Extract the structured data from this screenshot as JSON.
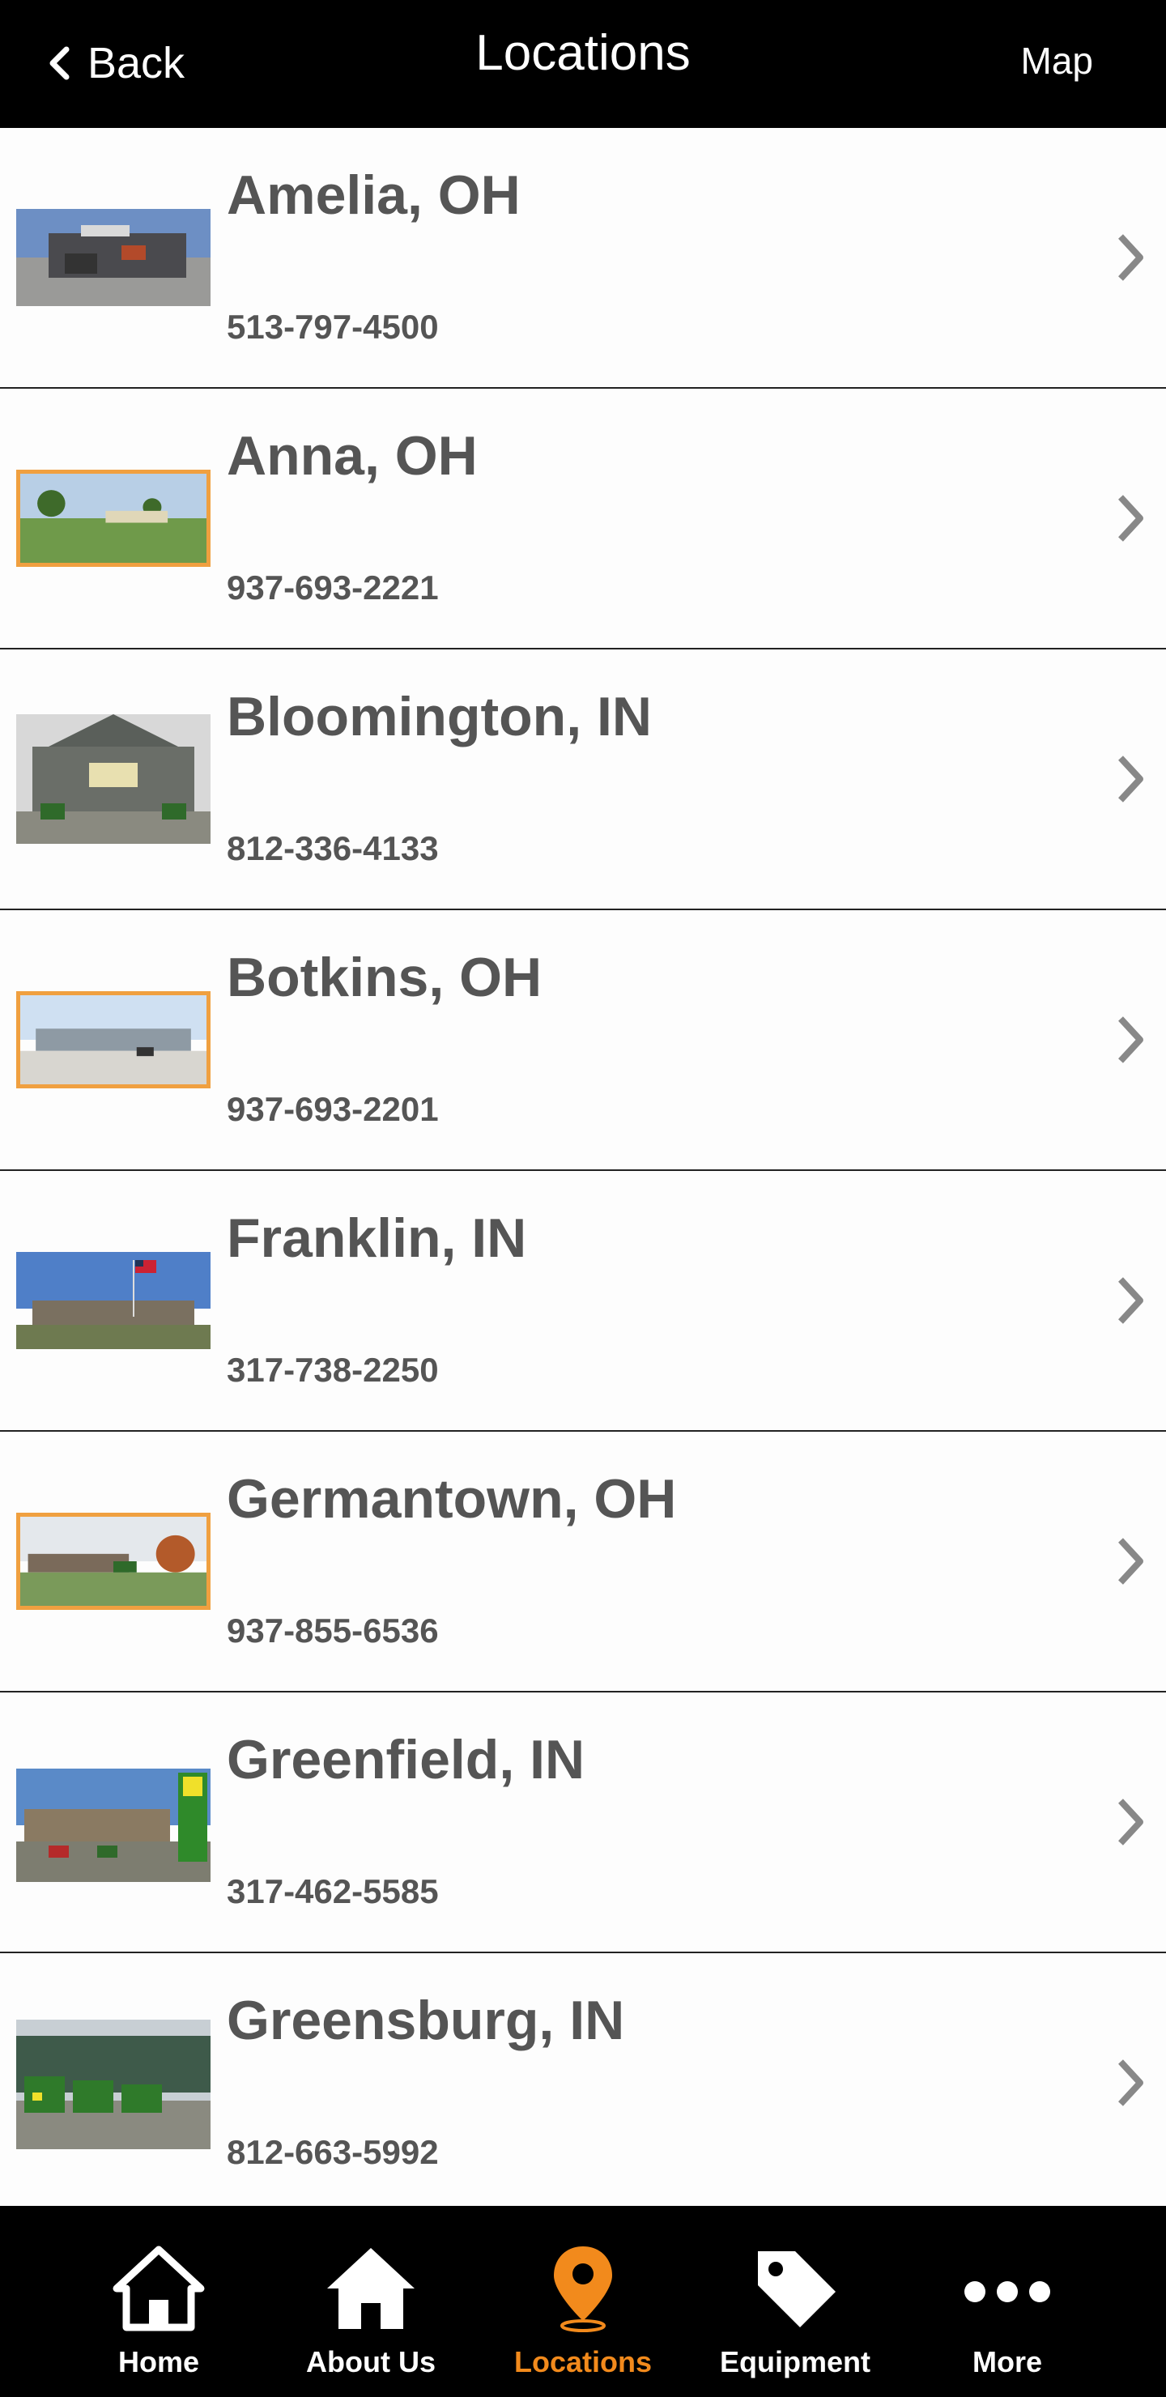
{
  "header": {
    "back_label": "Back",
    "title": "Locations",
    "map_label": "Map"
  },
  "locations": [
    {
      "name": "Amelia, OH",
      "phone": "513-797-4500"
    },
    {
      "name": "Anna, OH",
      "phone": "937-693-2221"
    },
    {
      "name": "Bloomington, IN",
      "phone": "812-336-4133"
    },
    {
      "name": "Botkins, OH",
      "phone": "937-693-2201"
    },
    {
      "name": "Franklin, IN",
      "phone": "317-738-2250"
    },
    {
      "name": "Germantown, OH",
      "phone": "937-855-6536"
    },
    {
      "name": "Greenfield, IN",
      "phone": "317-462-5585"
    },
    {
      "name": "Greensburg, IN",
      "phone": "812-663-5992"
    }
  ],
  "tabs": [
    {
      "label": "Home",
      "icon": "home-outline-icon"
    },
    {
      "label": "About Us",
      "icon": "home-solid-icon"
    },
    {
      "label": "Locations",
      "icon": "map-pin-icon"
    },
    {
      "label": "Equipment",
      "icon": "tag-icon"
    },
    {
      "label": "More",
      "icon": "more-dots-icon"
    }
  ],
  "colors": {
    "header_bg": "#000000",
    "active_tab": "#f28a1c",
    "text": "#555555",
    "thumb_loading_border": "#f0a040"
  }
}
